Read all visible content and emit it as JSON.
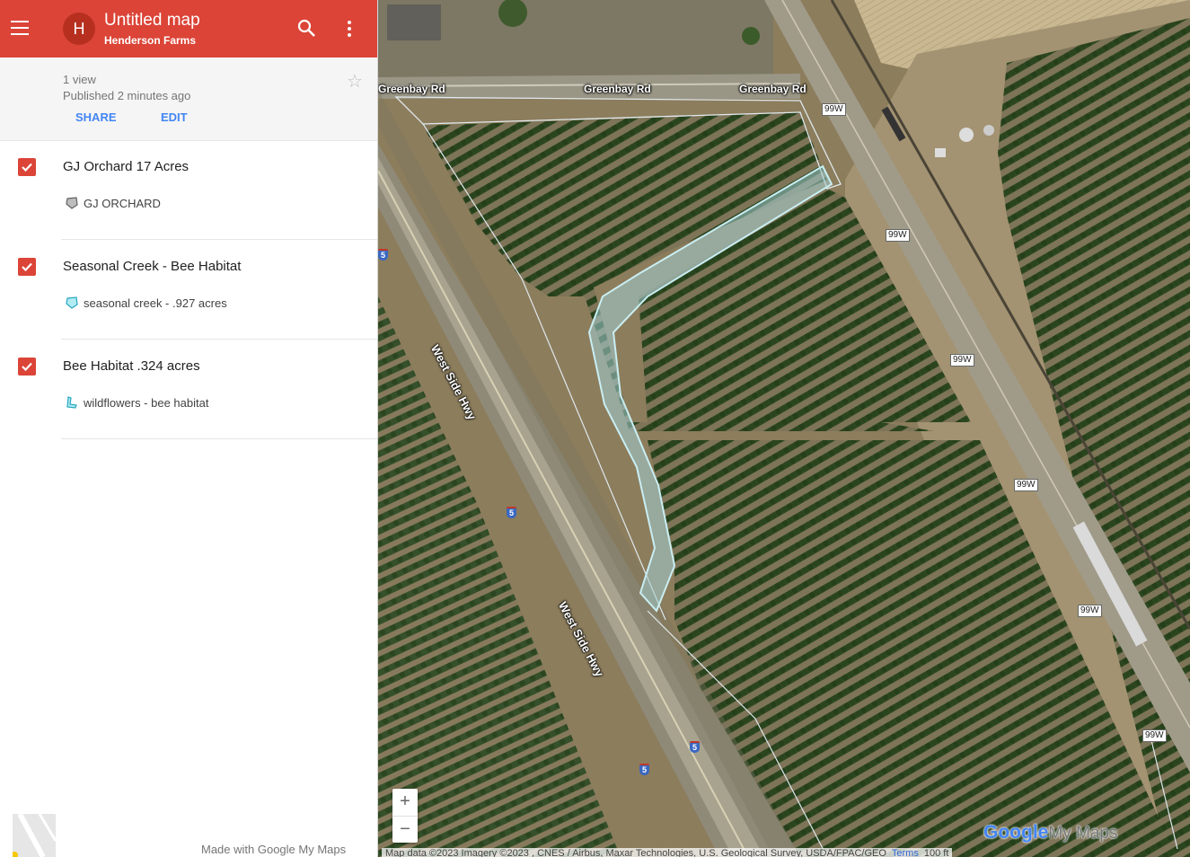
{
  "header": {
    "avatar_letter": "H",
    "title": "Untitled map",
    "owner": "Henderson Farms",
    "accent": "#db4437"
  },
  "info": {
    "views": "1 view",
    "published": "Published 2 minutes ago",
    "share_label": "SHARE",
    "edit_label": "EDIT"
  },
  "layers": [
    {
      "name": "GJ Orchard 17 Acres",
      "checked": true,
      "feature": {
        "icon": "polygon-icon",
        "label": "GJ ORCHARD"
      }
    },
    {
      "name": "Seasonal Creek - Bee Habitat",
      "checked": true,
      "feature": {
        "icon": "polygon-icon",
        "label": "seasonal creek - .927 acres"
      }
    },
    {
      "name": "Bee Habitat .324 acres",
      "checked": true,
      "feature": {
        "icon": "polygon-icon",
        "label": "wildflowers - bee habitat"
      }
    }
  ],
  "footer": {
    "credit": "Made with Google My Maps"
  },
  "map": {
    "road_labels": [
      "Greenbay Rd",
      "Greenbay Rd",
      "Greenbay Rd",
      "West Side Hwy",
      "West Side Hwy"
    ],
    "route_99w": "99W",
    "route_i5": "5",
    "zoom_in": "+",
    "zoom_out": "−",
    "logo": {
      "google": "Google",
      "mymaps": "My Maps"
    },
    "attribution": "Map data ©2023 Imagery ©2023 , CNES / Airbus, Maxar Technologies, U.S. Geological Survey, USDA/FPAC/GEO",
    "terms": "Terms",
    "scale": "100 ft"
  }
}
